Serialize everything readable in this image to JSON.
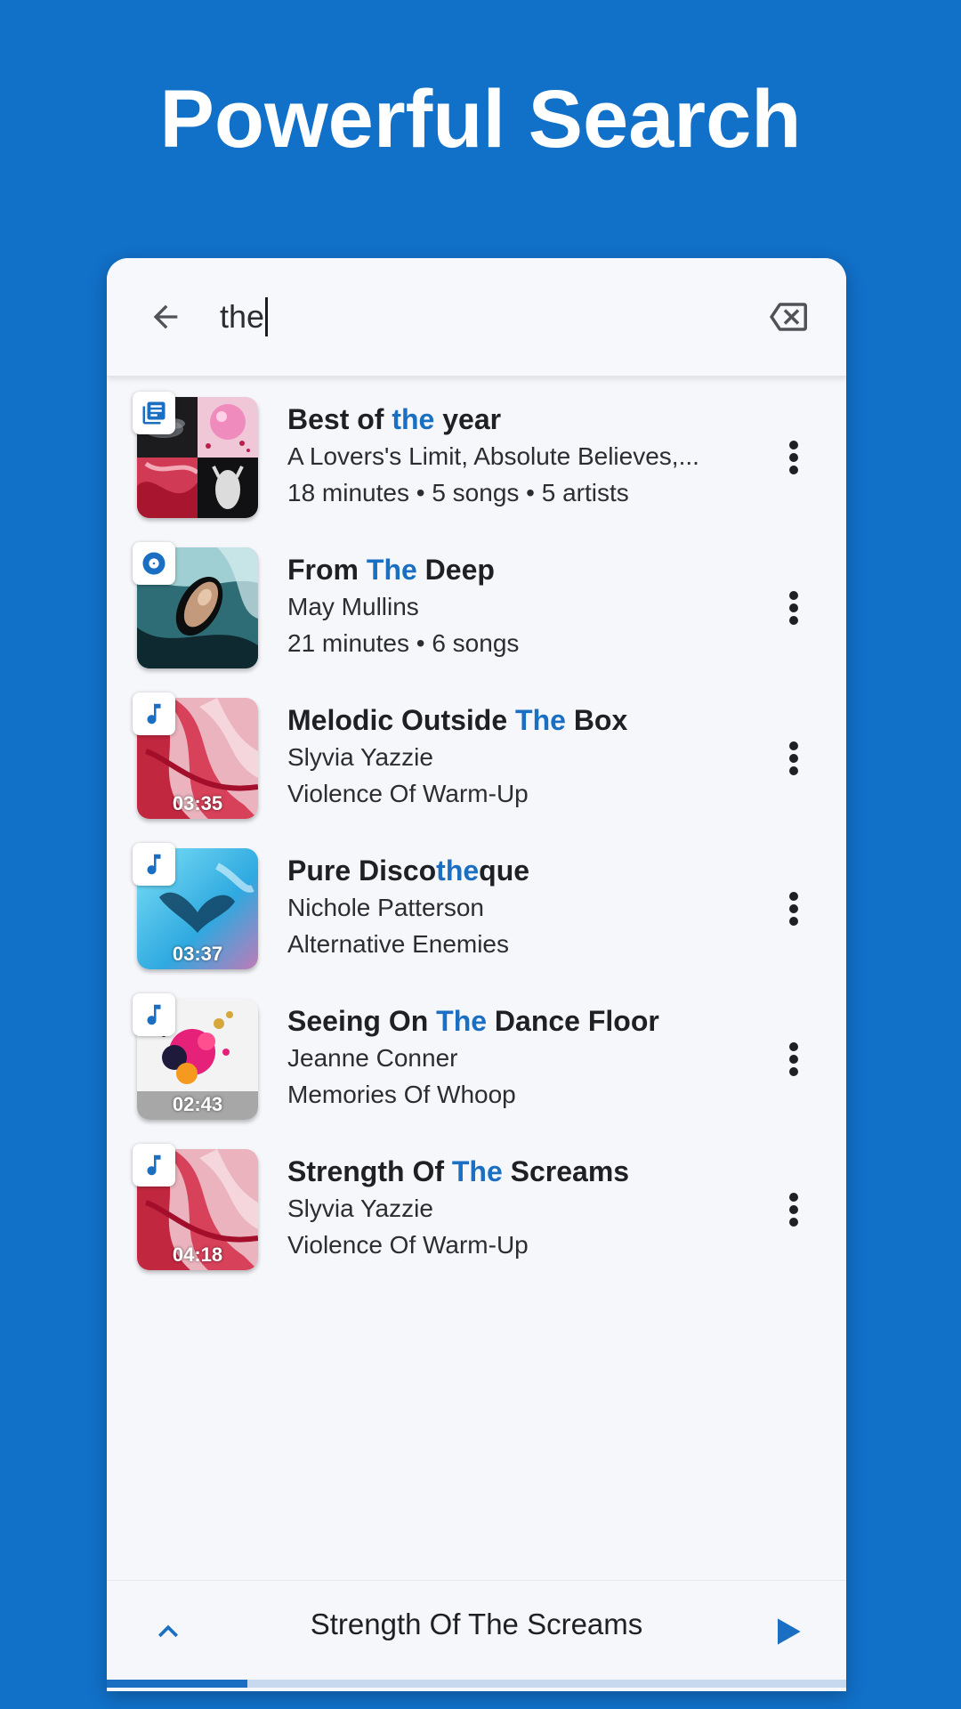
{
  "promo": {
    "title": "Powerful Search"
  },
  "search": {
    "query": "the"
  },
  "results": [
    {
      "type": "playlist",
      "title_pre": "Best of ",
      "title_hl": "the",
      "title_post": " year",
      "line1": "A Lovers's Limit, Absolute Believes,...",
      "line2": "18 minutes • 5 songs • 5 artists",
      "duration": ""
    },
    {
      "type": "album",
      "title_pre": "From ",
      "title_hl": "The",
      "title_post": " Deep",
      "line1": "May Mullins",
      "line2": "21 minutes • 6 songs",
      "duration": ""
    },
    {
      "type": "song",
      "title_pre": "Melodic Outside ",
      "title_hl": "The",
      "title_post": " Box",
      "line1": "Slyvia Yazzie",
      "line2": "Violence Of Warm-Up",
      "duration": "03:35"
    },
    {
      "type": "song",
      "title_pre": "Pure Disco",
      "title_hl": "the",
      "title_post": "que",
      "line1": "Nichole Patterson",
      "line2": "Alternative Enemies",
      "duration": "03:37"
    },
    {
      "type": "song",
      "title_pre": "Seeing On ",
      "title_hl": "The",
      "title_post": " Dance Floor",
      "line1": "Jeanne Conner",
      "line2": "Memories Of Whoop",
      "duration": "02:43"
    },
    {
      "type": "song",
      "title_pre": "Strength Of ",
      "title_hl": "The",
      "title_post": " Screams",
      "line1": "Slyvia Yazzie",
      "line2": "Violence Of Warm-Up",
      "duration": "04:18"
    }
  ],
  "player": {
    "now_playing": "Strength Of The Screams",
    "progress": 0.19
  },
  "colors": {
    "background": "#1170c8",
    "accent": "#1a6fc2",
    "surface": "#f6f7fb"
  },
  "icons": {
    "back": "arrow-back-icon",
    "clear": "backspace-icon",
    "more": "more-vert-icon",
    "playlist": "playlist-icon",
    "album": "album-icon",
    "song": "music-note-icon",
    "expand": "chevron-up-icon",
    "play": "play-icon"
  }
}
